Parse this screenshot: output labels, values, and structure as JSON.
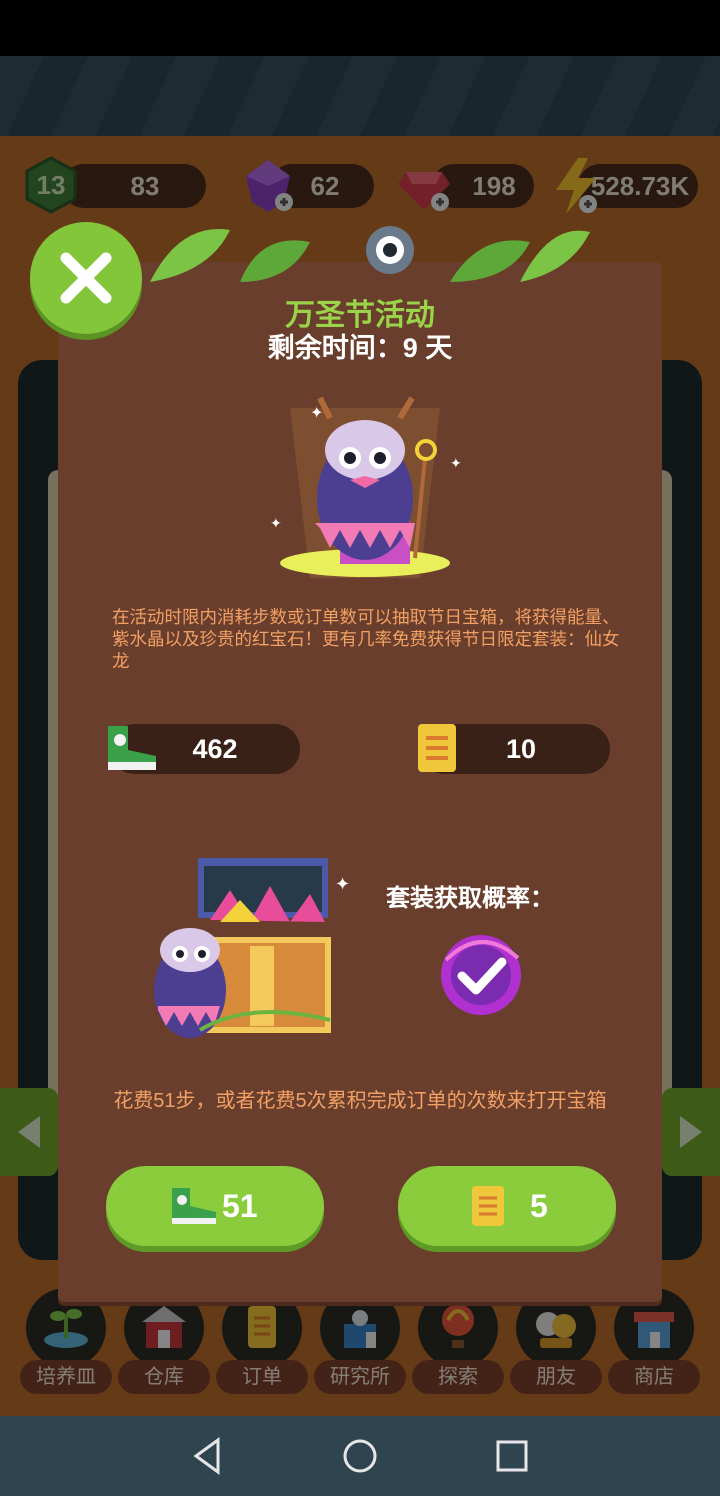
{
  "resources": {
    "level": "13",
    "xp": "83",
    "crystals": "62",
    "rubies": "198",
    "energy": "528.73K"
  },
  "event": {
    "title": "万圣节活动",
    "remaining_time": "剩余时间：9 天",
    "description": "在活动时限内消耗步数或订单数可以抽取节日宝箱，将获得能量、紫水晶以及珍贵的红宝石！更有几率免费获得节日限定套装：仙女龙",
    "steps_owned": "462",
    "orders_owned": "10",
    "set_rate_label": "套装获取概率：",
    "cost_text": "花费51步，或者花费5次累积完成订单的次数来打开宝箱",
    "steps_cost": "51",
    "orders_cost": "5"
  },
  "bottom_nav": [
    {
      "label": "培养皿",
      "icon": "petri-dish-icon"
    },
    {
      "label": "仓库",
      "icon": "warehouse-icon"
    },
    {
      "label": "订单",
      "icon": "order-scroll-icon"
    },
    {
      "label": "研究所",
      "icon": "lab-icon"
    },
    {
      "label": "探索",
      "icon": "balloon-icon"
    },
    {
      "label": "朋友",
      "icon": "friends-icon"
    },
    {
      "label": "商店",
      "icon": "shop-icon"
    }
  ],
  "colors": {
    "panel": "#6a3e2c",
    "accent_green": "#8bcc3c",
    "title_green": "#9bd34a",
    "desc_orange": "#f2a064"
  }
}
